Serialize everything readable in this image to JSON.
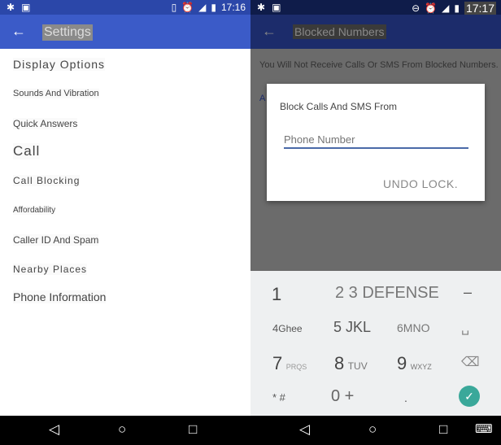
{
  "left": {
    "status": {
      "time": "17:16",
      "icons": [
        "bug-icon",
        "image-icon",
        "vibrate-icon",
        "alarm-icon",
        "signal-icon",
        "battery-icon"
      ]
    },
    "appbar": {
      "back": "←",
      "title": "Settings",
      "color": "#3b5bc8"
    },
    "items": [
      {
        "label": "Display Options"
      },
      {
        "label": "Sounds And Vibration"
      },
      {
        "label": "Quick Answers"
      },
      {
        "label": "Call"
      },
      {
        "label": "Call Blocking"
      },
      {
        "label": "Affordability"
      },
      {
        "label": "Caller ID And Spam"
      },
      {
        "label": "Nearby Places"
      },
      {
        "label": "Phone Information"
      }
    ]
  },
  "right": {
    "status": {
      "time": "17:17",
      "icons": [
        "bug-icon",
        "image-icon",
        "dnd-icon",
        "alarm-icon",
        "signal-icon",
        "battery-icon"
      ]
    },
    "appbar": {
      "back": "←",
      "title": "Blocked Numbers",
      "color": "#1c2c6b"
    },
    "description": "You Will Not Receive Calls Or SMS From Blocked Numbers.",
    "add_partial": "A",
    "dialog": {
      "title": "Block Calls And SMS From",
      "input_placeholder": "Phone Number",
      "button": "UNDO LOCK."
    },
    "keypad": {
      "rows": [
        [
          {
            "n": "1",
            "s": ""
          },
          {
            "n": "2 3 DEFENSE",
            "s": ""
          },
          {
            "n": "–",
            "s": ""
          }
        ],
        [
          {
            "n": "4",
            "s": "Ghee"
          },
          {
            "n": "5",
            "s": "JKL"
          },
          {
            "n": "6",
            "s": "MNO"
          },
          {
            "n": "␣",
            "s": ""
          }
        ],
        [
          {
            "n": "7",
            "s": "PRQS"
          },
          {
            "n": "8",
            "s": "TUV"
          },
          {
            "n": "9",
            "s": "WXYZ"
          },
          {
            "n": "⌫",
            "s": ""
          }
        ],
        [
          {
            "n": "* #",
            "s": ""
          },
          {
            "n": "0 +",
            "s": ""
          },
          {
            "n": ".",
            "s": ""
          },
          {
            "n": "✓",
            "s": ""
          }
        ]
      ],
      "accent": "#3aa89a"
    }
  },
  "nav": {
    "back": "◁",
    "home": "○",
    "recents": "□",
    "keyboard": "⌨"
  }
}
